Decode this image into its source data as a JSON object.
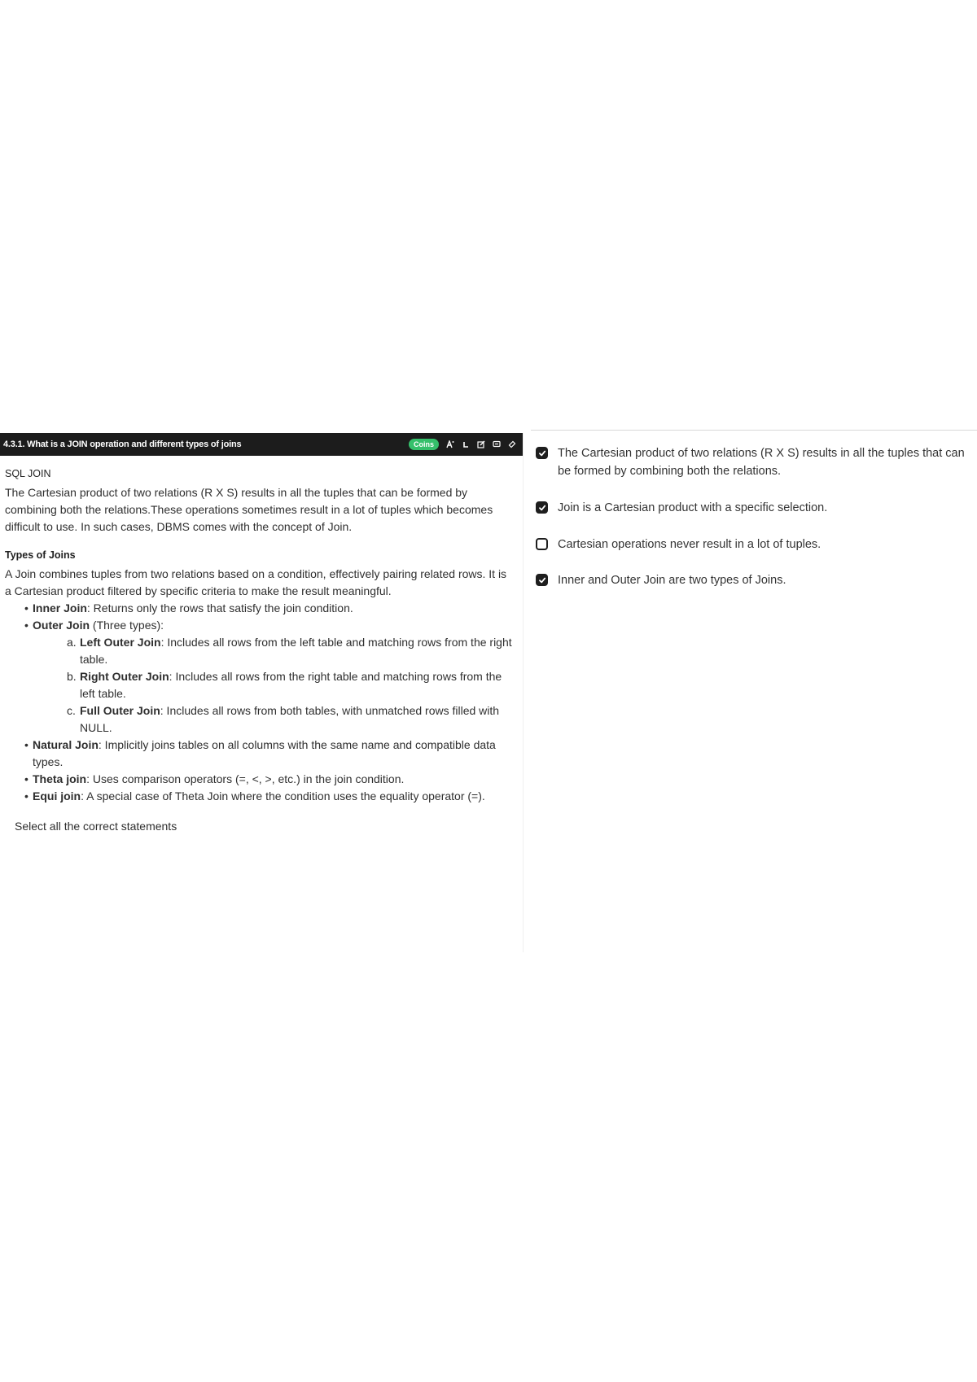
{
  "topbar": {
    "title": "4.3.1. What is a JOIN operation and different types of joins",
    "badge": "Coins",
    "tools": [
      "ai-icon",
      "refresh-icon",
      "edit-icon",
      "comment-icon",
      "link-icon"
    ]
  },
  "content": {
    "heading": "SQL JOIN",
    "intro": "The Cartesian product of two relations (R X S) results in all the tuples that can be formed by combining both the relations.These operations sometimes result in a lot of tuples which becomes difficult to use. In such cases, DBMS comes with the concept of Join.",
    "types_heading": "Types of Joins",
    "types_intro": "A Join combines tuples from two relations based on a condition, effectively pairing related rows. It is a Cartesian product filtered by specific criteria to make the result meaningful.",
    "inner": {
      "name": "Inner Join",
      "desc": ": Returns only the rows that satisfy the join condition."
    },
    "outer": {
      "name": "Outer Join",
      "desc": " (Three types):"
    },
    "outer_types": [
      {
        "letter": "a.",
        "name": "Left Outer Join",
        "desc": ": Includes all rows from the left table and matching rows from the right table."
      },
      {
        "letter": "b.",
        "name": "Right Outer Join",
        "desc": ": Includes all rows from the right table and matching rows from the left table."
      },
      {
        "letter": "c.",
        "name": "Full Outer Join",
        "desc": ": Includes all rows from both tables, with unmatched rows filled with NULL."
      }
    ],
    "natural": {
      "name": "Natural Join",
      "desc": ": Implicitly joins tables on all columns with the same name and compatible data types."
    },
    "theta": {
      "name": "Theta join",
      "desc": ": Uses comparison operators (=, <, >, etc.) in the join condition."
    },
    "equi": {
      "name": "Equi join",
      "desc": ": A special case of Theta Join where the condition uses the equality operator (=)."
    },
    "prompt": "Select all the correct statements"
  },
  "options": [
    {
      "text": "The Cartesian product of two relations (R X S) results in all the tuples that can be formed by combining both the relations.",
      "checked": true
    },
    {
      "text": "Join is a Cartesian product with a specific selection.",
      "checked": true
    },
    {
      "text": "Cartesian operations never result in a lot of tuples.",
      "checked": false
    },
    {
      "text": "Inner and Outer Join are two types of Joins.",
      "checked": true
    }
  ]
}
